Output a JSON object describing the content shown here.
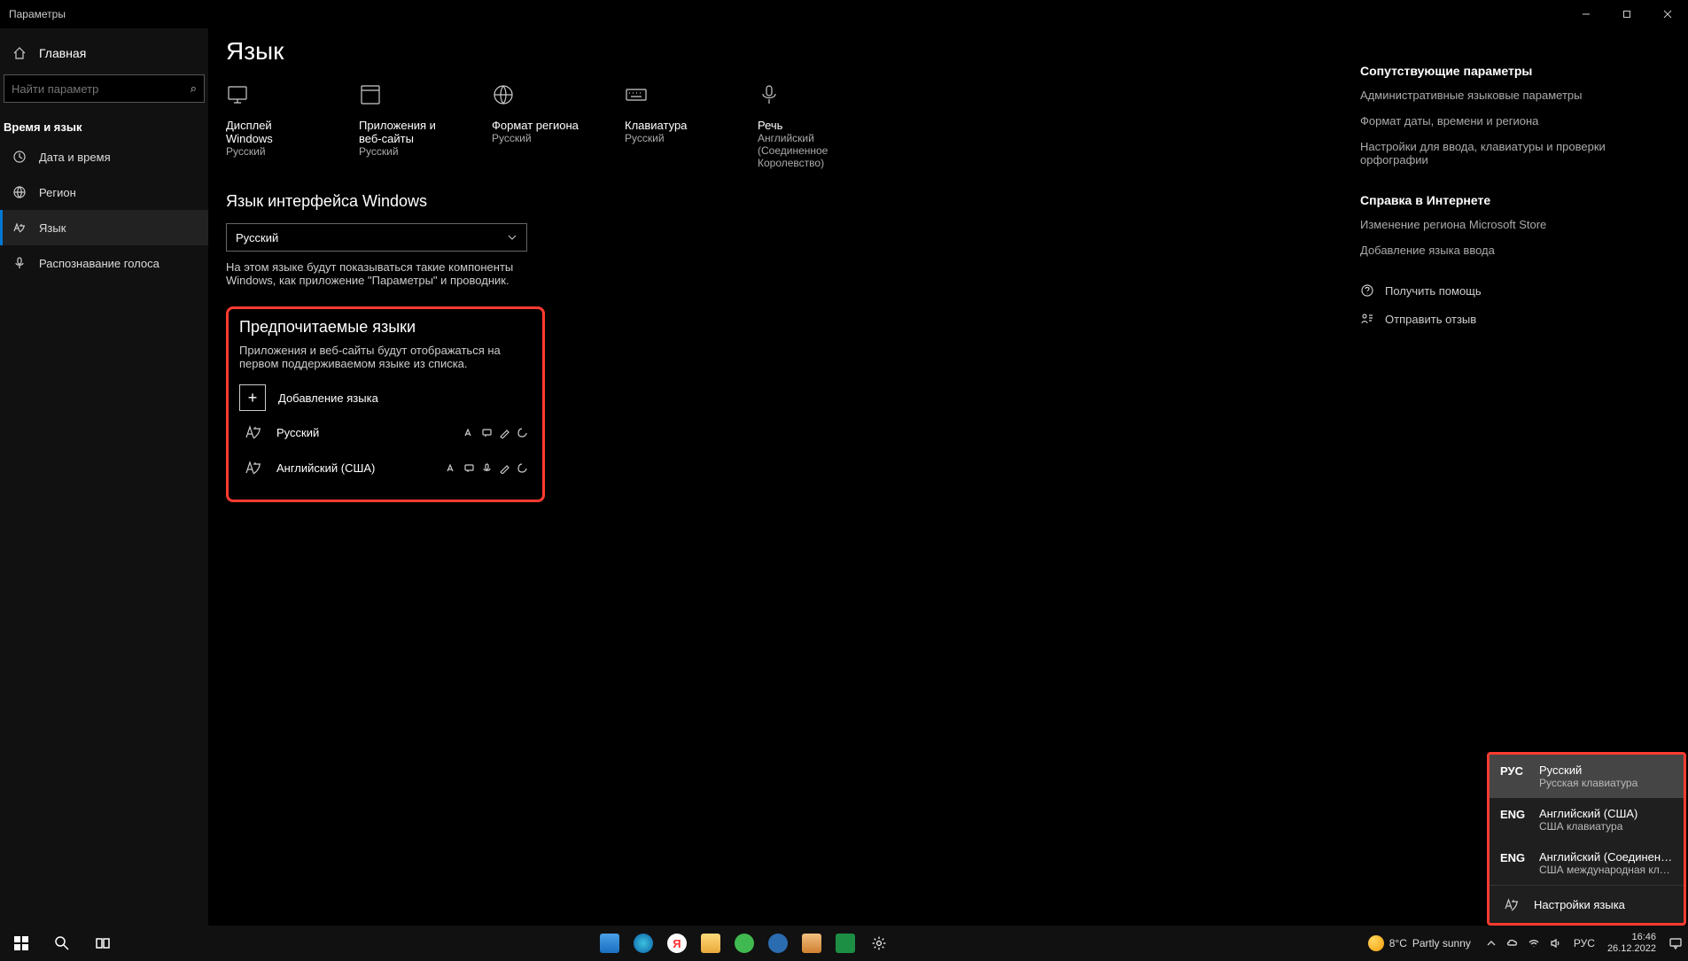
{
  "window": {
    "title": "Параметры"
  },
  "sidebar": {
    "home": "Главная",
    "search_placeholder": "Найти параметр",
    "section": "Время и язык",
    "items": [
      {
        "label": "Дата и время"
      },
      {
        "label": "Регион"
      },
      {
        "label": "Язык"
      },
      {
        "label": "Распознавание голоса"
      }
    ]
  },
  "page": {
    "title": "Язык",
    "tiles": [
      {
        "title": "Дисплей Windows",
        "sub": "Русский"
      },
      {
        "title": "Приложения и веб-сайты",
        "sub": "Русский"
      },
      {
        "title": "Формат региона",
        "sub": "Русский"
      },
      {
        "title": "Клавиатура",
        "sub": "Русский"
      },
      {
        "title": "Речь",
        "sub": "Английский (Соединенное Королевство)"
      }
    ],
    "display_lang_section": "Язык интерфейса Windows",
    "display_lang_value": "Русский",
    "display_lang_help": "На этом языке будут показываться такие компоненты Windows, как приложение \"Параметры\" и проводник.",
    "preferred_section": "Предпочитаемые языки",
    "preferred_help": "Приложения и веб-сайты будут отображаться на первом поддерживаемом языке из списка.",
    "add_language": "Добавление языка",
    "lang_rows": [
      {
        "name": "Русский"
      },
      {
        "name": "Английский (США)"
      }
    ]
  },
  "rightpane": {
    "related_head": "Сопутствующие параметры",
    "related": [
      "Административные языковые параметры",
      "Формат даты, времени и региона",
      "Настройки для ввода, клавиатуры и проверки орфографии"
    ],
    "help_head": "Справка в Интернете",
    "help_links": [
      "Изменение региона Microsoft Store",
      "Добавление языка ввода"
    ],
    "get_help": "Получить помощь",
    "feedback": "Отправить отзыв"
  },
  "lang_popup": {
    "rows": [
      {
        "code": "РУС",
        "name": "Русский",
        "sub": "Русская клавиатура",
        "selected": true
      },
      {
        "code": "ENG",
        "name": "Английский (США)",
        "sub": "США клавиатура",
        "selected": false
      },
      {
        "code": "ENG",
        "name": "Английский (Соединенное...",
        "sub": "США международная клави...",
        "selected": false
      }
    ],
    "settings": "Настройки языка"
  },
  "taskbar": {
    "weather_temp": "8°C",
    "weather_text": "Partly sunny",
    "lang": "РУС",
    "time": "16:46",
    "date": "26.12.2022"
  }
}
